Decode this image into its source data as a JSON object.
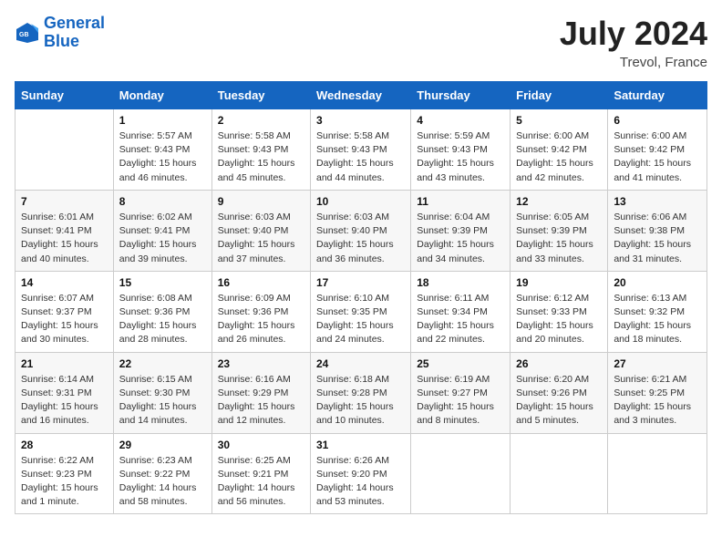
{
  "logo": {
    "line1": "General",
    "line2": "Blue"
  },
  "title": "July 2024",
  "location": "Trevol, France",
  "days_header": [
    "Sunday",
    "Monday",
    "Tuesday",
    "Wednesday",
    "Thursday",
    "Friday",
    "Saturday"
  ],
  "weeks": [
    [
      {
        "day": "",
        "sunrise": "",
        "sunset": "",
        "daylight": ""
      },
      {
        "day": "1",
        "sunrise": "Sunrise: 5:57 AM",
        "sunset": "Sunset: 9:43 PM",
        "daylight": "Daylight: 15 hours and 46 minutes."
      },
      {
        "day": "2",
        "sunrise": "Sunrise: 5:58 AM",
        "sunset": "Sunset: 9:43 PM",
        "daylight": "Daylight: 15 hours and 45 minutes."
      },
      {
        "day": "3",
        "sunrise": "Sunrise: 5:58 AM",
        "sunset": "Sunset: 9:43 PM",
        "daylight": "Daylight: 15 hours and 44 minutes."
      },
      {
        "day": "4",
        "sunrise": "Sunrise: 5:59 AM",
        "sunset": "Sunset: 9:43 PM",
        "daylight": "Daylight: 15 hours and 43 minutes."
      },
      {
        "day": "5",
        "sunrise": "Sunrise: 6:00 AM",
        "sunset": "Sunset: 9:42 PM",
        "daylight": "Daylight: 15 hours and 42 minutes."
      },
      {
        "day": "6",
        "sunrise": "Sunrise: 6:00 AM",
        "sunset": "Sunset: 9:42 PM",
        "daylight": "Daylight: 15 hours and 41 minutes."
      }
    ],
    [
      {
        "day": "7",
        "sunrise": "Sunrise: 6:01 AM",
        "sunset": "Sunset: 9:41 PM",
        "daylight": "Daylight: 15 hours and 40 minutes."
      },
      {
        "day": "8",
        "sunrise": "Sunrise: 6:02 AM",
        "sunset": "Sunset: 9:41 PM",
        "daylight": "Daylight: 15 hours and 39 minutes."
      },
      {
        "day": "9",
        "sunrise": "Sunrise: 6:03 AM",
        "sunset": "Sunset: 9:40 PM",
        "daylight": "Daylight: 15 hours and 37 minutes."
      },
      {
        "day": "10",
        "sunrise": "Sunrise: 6:03 AM",
        "sunset": "Sunset: 9:40 PM",
        "daylight": "Daylight: 15 hours and 36 minutes."
      },
      {
        "day": "11",
        "sunrise": "Sunrise: 6:04 AM",
        "sunset": "Sunset: 9:39 PM",
        "daylight": "Daylight: 15 hours and 34 minutes."
      },
      {
        "day": "12",
        "sunrise": "Sunrise: 6:05 AM",
        "sunset": "Sunset: 9:39 PM",
        "daylight": "Daylight: 15 hours and 33 minutes."
      },
      {
        "day": "13",
        "sunrise": "Sunrise: 6:06 AM",
        "sunset": "Sunset: 9:38 PM",
        "daylight": "Daylight: 15 hours and 31 minutes."
      }
    ],
    [
      {
        "day": "14",
        "sunrise": "Sunrise: 6:07 AM",
        "sunset": "Sunset: 9:37 PM",
        "daylight": "Daylight: 15 hours and 30 minutes."
      },
      {
        "day": "15",
        "sunrise": "Sunrise: 6:08 AM",
        "sunset": "Sunset: 9:36 PM",
        "daylight": "Daylight: 15 hours and 28 minutes."
      },
      {
        "day": "16",
        "sunrise": "Sunrise: 6:09 AM",
        "sunset": "Sunset: 9:36 PM",
        "daylight": "Daylight: 15 hours and 26 minutes."
      },
      {
        "day": "17",
        "sunrise": "Sunrise: 6:10 AM",
        "sunset": "Sunset: 9:35 PM",
        "daylight": "Daylight: 15 hours and 24 minutes."
      },
      {
        "day": "18",
        "sunrise": "Sunrise: 6:11 AM",
        "sunset": "Sunset: 9:34 PM",
        "daylight": "Daylight: 15 hours and 22 minutes."
      },
      {
        "day": "19",
        "sunrise": "Sunrise: 6:12 AM",
        "sunset": "Sunset: 9:33 PM",
        "daylight": "Daylight: 15 hours and 20 minutes."
      },
      {
        "day": "20",
        "sunrise": "Sunrise: 6:13 AM",
        "sunset": "Sunset: 9:32 PM",
        "daylight": "Daylight: 15 hours and 18 minutes."
      }
    ],
    [
      {
        "day": "21",
        "sunrise": "Sunrise: 6:14 AM",
        "sunset": "Sunset: 9:31 PM",
        "daylight": "Daylight: 15 hours and 16 minutes."
      },
      {
        "day": "22",
        "sunrise": "Sunrise: 6:15 AM",
        "sunset": "Sunset: 9:30 PM",
        "daylight": "Daylight: 15 hours and 14 minutes."
      },
      {
        "day": "23",
        "sunrise": "Sunrise: 6:16 AM",
        "sunset": "Sunset: 9:29 PM",
        "daylight": "Daylight: 15 hours and 12 minutes."
      },
      {
        "day": "24",
        "sunrise": "Sunrise: 6:18 AM",
        "sunset": "Sunset: 9:28 PM",
        "daylight": "Daylight: 15 hours and 10 minutes."
      },
      {
        "day": "25",
        "sunrise": "Sunrise: 6:19 AM",
        "sunset": "Sunset: 9:27 PM",
        "daylight": "Daylight: 15 hours and 8 minutes."
      },
      {
        "day": "26",
        "sunrise": "Sunrise: 6:20 AM",
        "sunset": "Sunset: 9:26 PM",
        "daylight": "Daylight: 15 hours and 5 minutes."
      },
      {
        "day": "27",
        "sunrise": "Sunrise: 6:21 AM",
        "sunset": "Sunset: 9:25 PM",
        "daylight": "Daylight: 15 hours and 3 minutes."
      }
    ],
    [
      {
        "day": "28",
        "sunrise": "Sunrise: 6:22 AM",
        "sunset": "Sunset: 9:23 PM",
        "daylight": "Daylight: 15 hours and 1 minute."
      },
      {
        "day": "29",
        "sunrise": "Sunrise: 6:23 AM",
        "sunset": "Sunset: 9:22 PM",
        "daylight": "Daylight: 14 hours and 58 minutes."
      },
      {
        "day": "30",
        "sunrise": "Sunrise: 6:25 AM",
        "sunset": "Sunset: 9:21 PM",
        "daylight": "Daylight: 14 hours and 56 minutes."
      },
      {
        "day": "31",
        "sunrise": "Sunrise: 6:26 AM",
        "sunset": "Sunset: 9:20 PM",
        "daylight": "Daylight: 14 hours and 53 minutes."
      },
      {
        "day": "",
        "sunrise": "",
        "sunset": "",
        "daylight": ""
      },
      {
        "day": "",
        "sunrise": "",
        "sunset": "",
        "daylight": ""
      },
      {
        "day": "",
        "sunrise": "",
        "sunset": "",
        "daylight": ""
      }
    ]
  ]
}
